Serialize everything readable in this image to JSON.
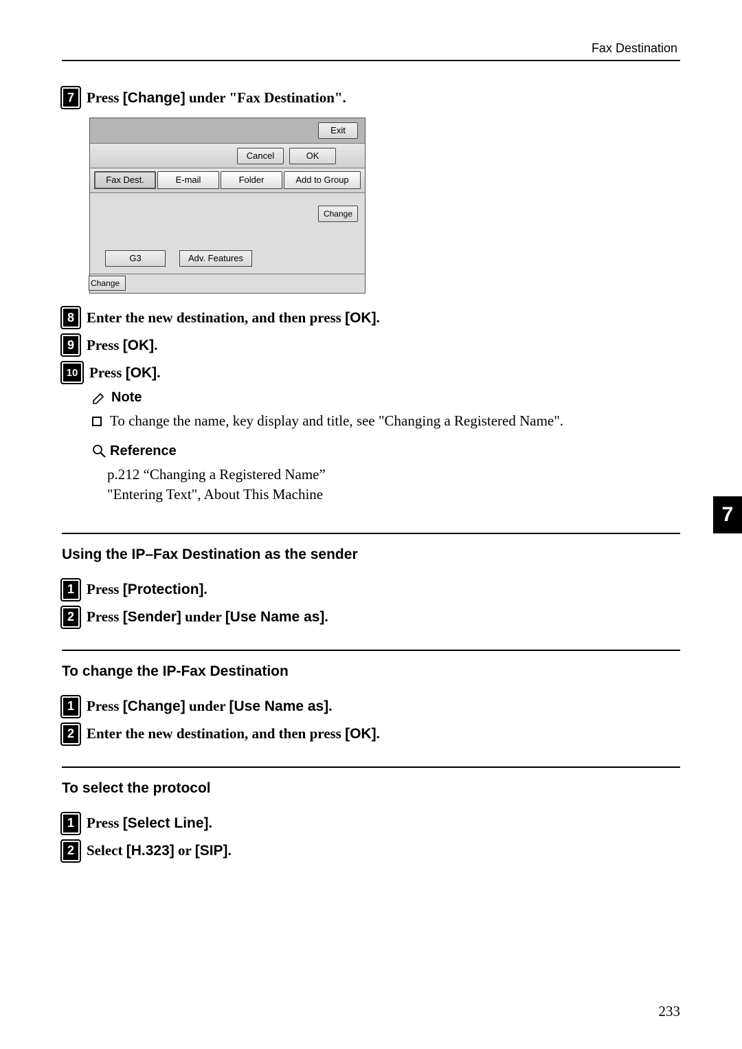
{
  "header": {
    "section": "Fax Destination"
  },
  "steps_a": {
    "7": {
      "num": "7",
      "text_pre": "Press ",
      "kb": "[Change]",
      "text_post": " under \"Fax Destination\"."
    },
    "8": {
      "num": "8",
      "text_pre": "Enter the new destination, and then press ",
      "kb": "[OK]",
      "text_post": "."
    },
    "9": {
      "num": "9",
      "text_pre": "Press ",
      "kb": "[OK]",
      "text_post": "."
    },
    "10": {
      "num": "10",
      "text_pre": "Press ",
      "kb": "[OK]",
      "text_post": "."
    }
  },
  "panel": {
    "exit": "Exit",
    "cancel": "Cancel",
    "ok": "OK",
    "tab_fax": "Fax Dest.",
    "tab_email": "E-mail",
    "tab_folder": "Folder",
    "tab_add": "Add to Group",
    "change": "Change",
    "g3": "G3",
    "adv": "Adv. Features",
    "hange": "Change"
  },
  "note": {
    "title": "Note",
    "body": "To change the name, key display and title, see \"Changing a Registered Name\"."
  },
  "reference": {
    "title": "Reference",
    "line1": "p.212 “Changing a Registered Name”",
    "line2": "\"Entering Text\", About This Machine"
  },
  "section1": {
    "heading": "Using the IP–Fax Destination as the sender",
    "step1": {
      "num": "1",
      "text_pre": "Press ",
      "kb": "[Protection]",
      "text_post": "."
    },
    "step2": {
      "num": "2",
      "text_pre": "Press ",
      "kb1": "[Sender]",
      "mid": " under ",
      "kb2": "[Use Name as]",
      "text_post": "."
    }
  },
  "section2": {
    "heading": "To change the IP-Fax Destination",
    "step1": {
      "num": "1",
      "text_pre": "Press ",
      "kb1": "[Change]",
      "mid": " under ",
      "kb2": "[Use Name as]",
      "text_post": "."
    },
    "step2": {
      "num": "2",
      "text_pre": "Enter the new destination, and then press ",
      "kb": "[OK]",
      "text_post": "."
    }
  },
  "section3": {
    "heading": "To select the protocol",
    "step1": {
      "num": "1",
      "text_pre": "Press ",
      "kb": "[Select Line]",
      "text_post": "."
    },
    "step2": {
      "num": "2",
      "text_pre": "Select ",
      "kb1": "[H.323]",
      "mid": " or ",
      "kb2": "[SIP]",
      "text_post": "."
    }
  },
  "chapter": "7",
  "pagenum": "233"
}
